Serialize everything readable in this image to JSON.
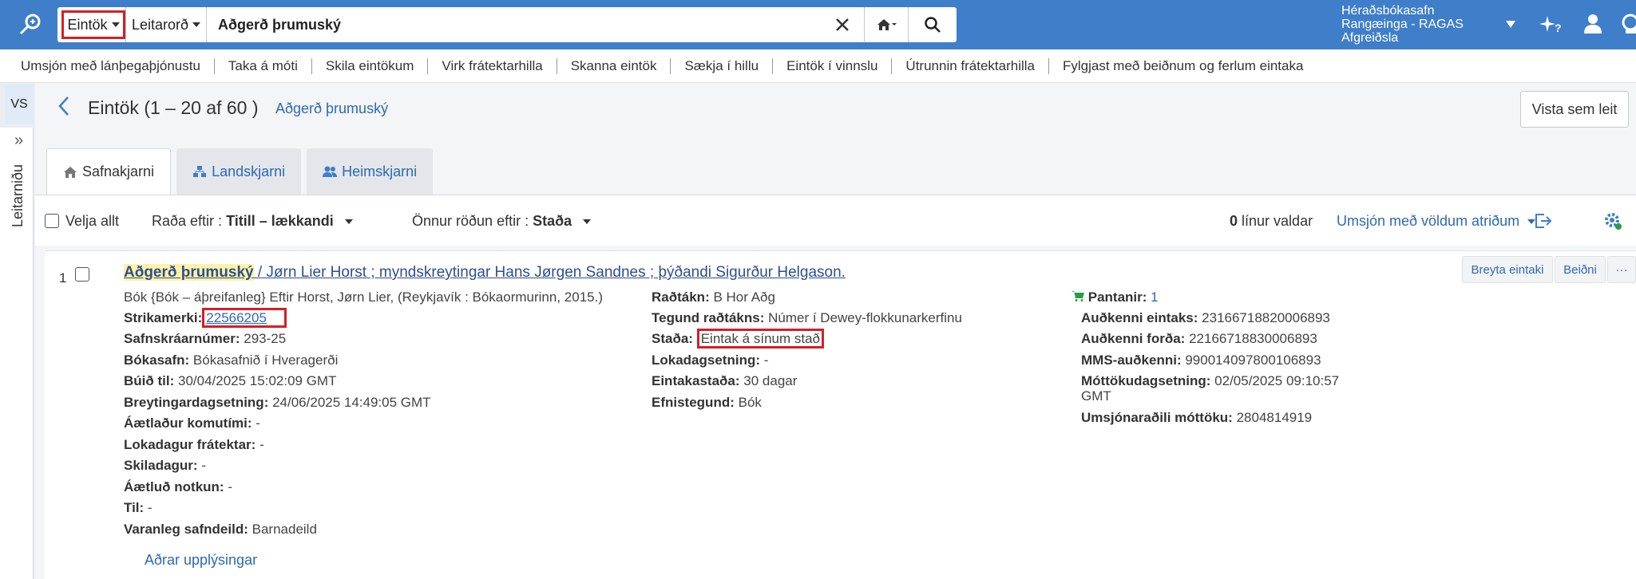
{
  "topbar": {
    "search_type": "Eintök",
    "search_field": "Leitarorð",
    "query": "Aðgerð þrumuský",
    "institution_line1": "Héraðsbókasafn",
    "institution_line2": "Rangæinga - RAGAS",
    "institution_line3": "Afgreiðsla"
  },
  "subnav": [
    "Umsjón með lánþegaþjónustu",
    "Taka á móti",
    "Skila eintökum",
    "Virk frátektarhilla",
    "Skanna eintök",
    "Sækja í hillu",
    "Eintök í vinnslu",
    "Útrunnin frátektarhilla",
    "Fylgjast með beiðnum og ferlum eintaka"
  ],
  "leftstrip": {
    "vs": "VS",
    "panel_label": "Leitarniðu"
  },
  "header": {
    "title": "Eintök (1 – 20 af 60 )",
    "query_link": "Aðgerð þrumuský",
    "view_button": "Vista sem leit"
  },
  "tabs": [
    "Safnakjarni",
    "Landskjarni",
    "Heimskjarni"
  ],
  "toolbar": {
    "select_all": "Velja allt",
    "sort_label": "Raða eftir :",
    "sort_value": "Titill – lækkandi",
    "sort2_label": "Önnur röðun eftir :",
    "sort2_value": "Staða",
    "selected_count": "0",
    "selected_label": "línur valdar",
    "bulk_actions": "Umsjón með völdum atriðum"
  },
  "record": {
    "number": "1",
    "title_highlight": "Aðgerð þrumuský",
    "title_rest": " / Jørn Lier Horst ; myndskreytingar Hans Jørgen Sandnes ; þýðandi Sigurður Helgason.",
    "type_label": "Bók {Bók – áþreifanleg}",
    "type_rest": " Eftir Horst, Jørn Lier, (Reykjavík : Bókaormurinn, 2015.)",
    "col1": [
      {
        "label": "Strikamerki:",
        "value": "22566205"
      },
      {
        "label": "Safnskráarnúmer:",
        "value": "293-25"
      },
      {
        "label": "Bókasafn:",
        "value": "Bókasafnið í Hveragerði"
      },
      {
        "label": "Búið til:",
        "value": "30/04/2025 15:02:09 GMT"
      },
      {
        "label": "Breytingardagsetning:",
        "value": "24/06/2025 14:49:05 GMT"
      },
      {
        "label": "Áætlaður komutími:",
        "value": "-"
      },
      {
        "label": "Lokadagur frátektar:",
        "value": "-"
      },
      {
        "label": "Skiladagur:",
        "value": "-"
      },
      {
        "label": "Áætluð notkun:",
        "value": "-"
      },
      {
        "label": "Til:",
        "value": "-"
      },
      {
        "label": "Varanleg safndeild:",
        "value": "Barnadeild"
      }
    ],
    "col2": [
      {
        "label": "Raðtákn:",
        "value": "B Hor Aðg"
      },
      {
        "label": "Tegund raðtákns:",
        "value": "Númer í Dewey-flokkunarkerfinu"
      },
      {
        "label": "Staða:",
        "value": "Eintak á sínum stað"
      },
      {
        "label": "Lokadagsetning:",
        "value": "-"
      },
      {
        "label": "Eintakastaða:",
        "value": "30 dagar"
      },
      {
        "label": "Efnistegund:",
        "value": "Bók"
      }
    ],
    "col3": [
      {
        "label": "Pantanir:",
        "value": "1"
      },
      {
        "label": "Auðkenni eintaks:",
        "value": "23166718820006893"
      },
      {
        "label": "Auðkenni forða:",
        "value": "22166718830006893"
      },
      {
        "label": "MMS-auðkenni:",
        "value": "990014097800106893"
      },
      {
        "label": "Móttökudagsetning:",
        "value": "02/05/2025 09:10:57"
      },
      {
        "label": "",
        "value": "GMT"
      },
      {
        "label": "Umsjónaraðili móttöku:",
        "value": "2804814919"
      }
    ],
    "edit_button": "Breyta eintaki",
    "request_button": "Beiðni",
    "more_button": "···",
    "more_info": "Aðrar upplýsingar"
  }
}
